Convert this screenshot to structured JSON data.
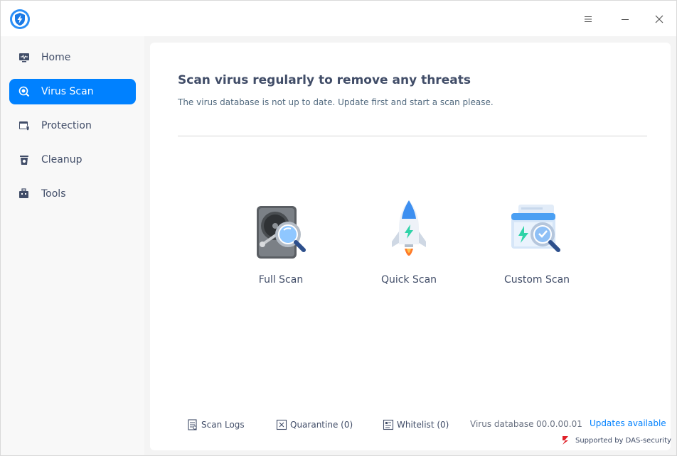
{
  "app": {
    "logo_icon": "shield-bolt-icon",
    "accent_color": "#0081ff"
  },
  "titlebar": {
    "menu_icon": "hamburger-menu-icon",
    "minimize_icon": "minimize-icon",
    "close_icon": "close-icon"
  },
  "sidebar": {
    "items": [
      {
        "label": "Home",
        "icon": "monitor-pulse-icon",
        "active": false
      },
      {
        "label": "Virus Scan",
        "icon": "scan-magnifier-icon",
        "active": true
      },
      {
        "label": "Protection",
        "icon": "window-shield-icon",
        "active": false
      },
      {
        "label": "Cleanup",
        "icon": "trash-bin-icon",
        "active": false
      },
      {
        "label": "Tools",
        "icon": "toolbox-icon",
        "active": false
      }
    ]
  },
  "main": {
    "heading": "Scan virus regularly to remove any threats",
    "subheading": "The virus database is not up to date. Update first and start a scan please.",
    "scan_options": [
      {
        "label": "Full Scan",
        "icon": "hard-drive-magnifier-icon"
      },
      {
        "label": "Quick Scan",
        "icon": "rocket-icon"
      },
      {
        "label": "Custom Scan",
        "icon": "folder-magnifier-icon"
      }
    ]
  },
  "footer": {
    "scan_logs": "Scan Logs",
    "quarantine": "Quarantine (0)",
    "whitelist": "Whitelist (0)",
    "db_label": "Virus database",
    "db_version": "00.0.00.01",
    "updates": "Updates available",
    "supported_by": "Supported by DAS-security"
  }
}
